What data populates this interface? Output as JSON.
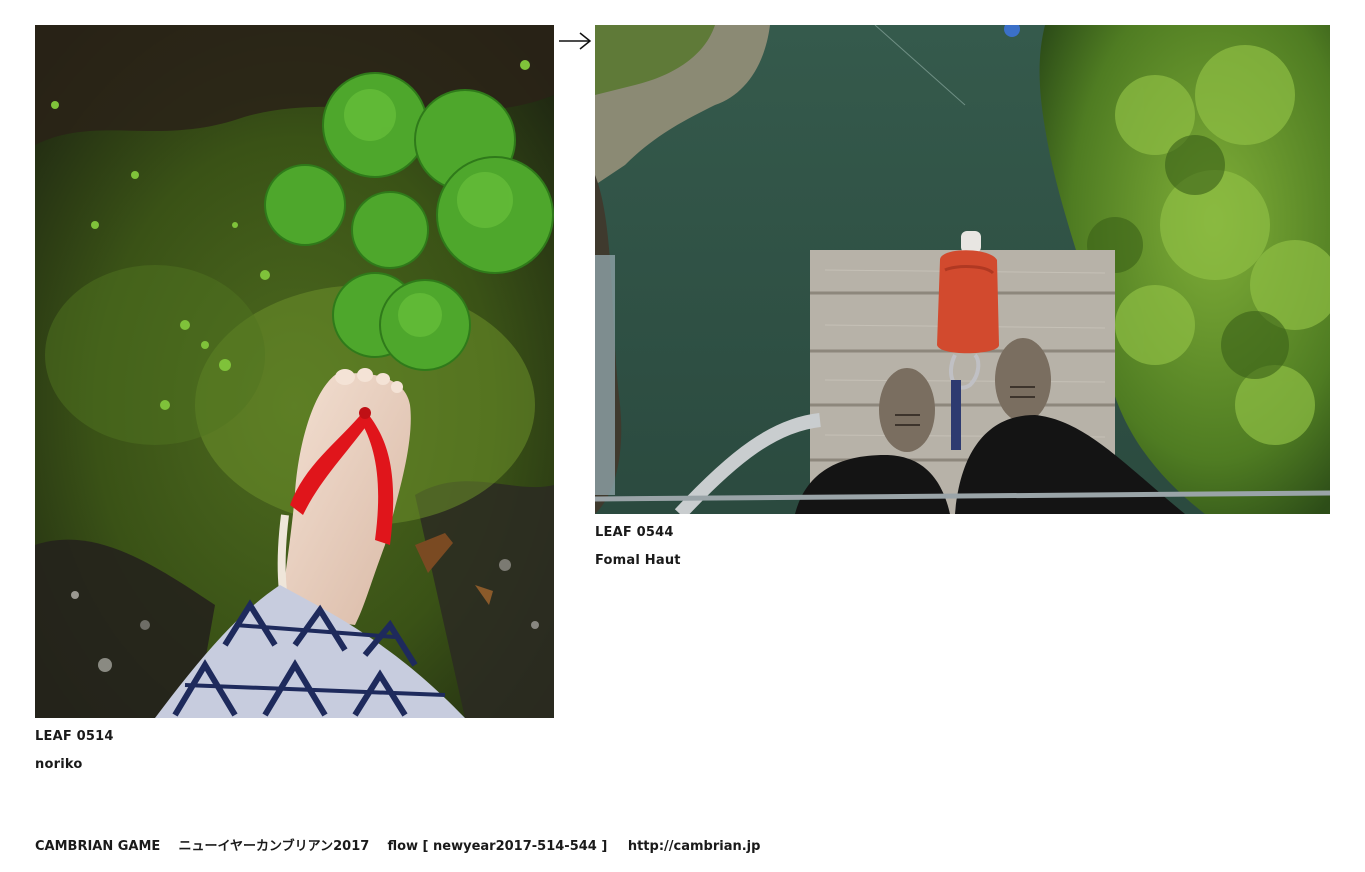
{
  "leaves": [
    {
      "id": "LEAF 0514",
      "author": "noriko"
    },
    {
      "id": "LEAF 0544",
      "author": "Fomal Haut"
    }
  ],
  "flow_arrow_icon": "right-arrow-icon",
  "footer": {
    "game": "CAMBRIAN GAME",
    "event": "ニューイヤーカンブリアン2017",
    "flow": "flow [ newyear2017-514-544 ]",
    "url": "http://cambrian.jp"
  },
  "colors": {
    "text": "#1a1a1a",
    "background": "#ffffff",
    "sandal_strap": "#e0151b",
    "river": "#2f4a40",
    "foliage": "#5f8f2a"
  }
}
